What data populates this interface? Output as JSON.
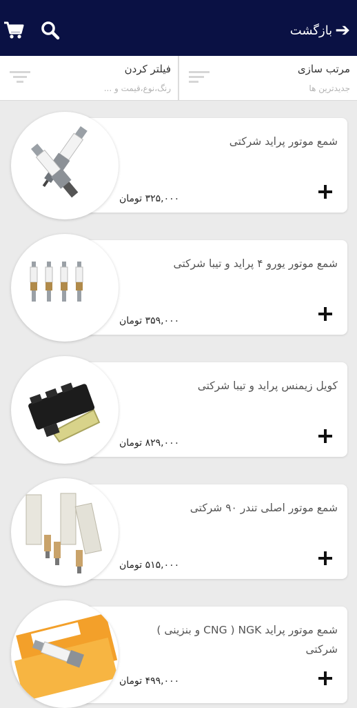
{
  "header": {
    "back_label": "بازگشت",
    "cart_icon": "shopping-cart-icon",
    "search_icon": "search-icon",
    "bg_color": "#0a1144"
  },
  "toolbar": {
    "sort": {
      "title": "مرتب سازی",
      "value": "جدیدترین ها"
    },
    "filter": {
      "title": "فیلتر کردن",
      "hint": "رنگ،نوع،قیمت و ..."
    }
  },
  "products": [
    {
      "name": "شمع موتور پراید شرکتی",
      "price": "۳۲۵,۰۰۰ تومان"
    },
    {
      "name": "شمع موتور یورو ۴ پراید و تیبا شرکتی",
      "price": "۳۵۹,۰۰۰ تومان"
    },
    {
      "name": "کویل زیمنس پراید و تیبا شرکتی",
      "price": "۸۲۹,۰۰۰ تومان"
    },
    {
      "name": "شمع موتور اصلی تندر ۹۰ شرکتی",
      "price": "۵۱۵,۰۰۰ تومان"
    },
    {
      "name": "شمع موتور  پراید NGK ( CNG و بنزینی ) شرکتی",
      "price": "۴۹۹,۰۰۰ تومان"
    }
  ]
}
